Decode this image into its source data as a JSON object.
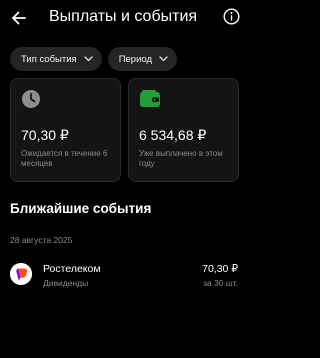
{
  "header": {
    "title": "Выплаты и события",
    "back_icon": "arrow-left-icon",
    "info_icon": "info-icon"
  },
  "filters": [
    {
      "label": "Тип события",
      "icon": "chevron-down-icon"
    },
    {
      "label": "Период",
      "icon": "chevron-down-icon"
    }
  ],
  "cards": {
    "expected": {
      "icon": "clock-icon",
      "amount": "70,30 ₽",
      "caption": "Ожидается в течение 6 месяцев"
    },
    "paid": {
      "icon": "wallet-icon",
      "amount": "6 534,68 ₽",
      "caption": "Уже выплачено в этом году",
      "icon_color": "#21a038"
    }
  },
  "upcoming": {
    "title": "Ближайшие события",
    "groups": [
      {
        "date": "28 августа 2025",
        "events": [
          {
            "name": "Ростелеком",
            "type": "Дивиденды",
            "amount": "70,30 ₽",
            "quantity": "за 30 шт.",
            "logo_icon": "rostelecom-logo-icon",
            "logo_colors": [
              "#ff4f12",
              "#7800ff"
            ]
          }
        ]
      }
    ]
  }
}
